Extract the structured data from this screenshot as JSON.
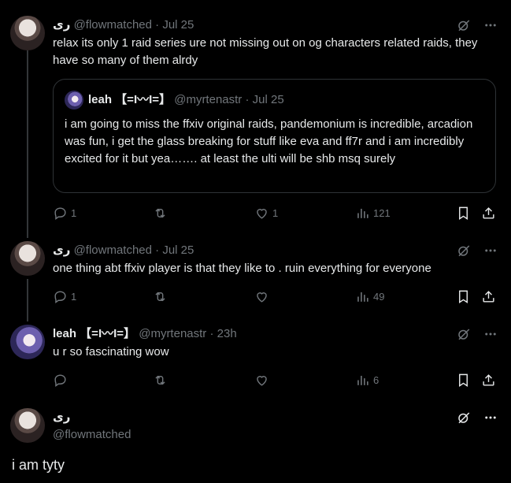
{
  "tweets": [
    {
      "name": "ری",
      "handle": "@flowmatched",
      "sep": "·",
      "time": "Jul 25",
      "text": "relax its only 1 raid series ure not missing out on og characters related raids, they have so many of them alrdy",
      "quote": {
        "name": "leah 【=Ι〰Ι=】",
        "handle": "@myrtenastr",
        "sep": "·",
        "time": "Jul 25",
        "text": "i am going to miss the ffxiv original raids, pandemonium is incredible, arcadion was fun, i get the glass breaking for stuff like eva and ff7r and i am incredibly excited for it but yea……. at least the ulti will be shb msq surely"
      },
      "replies": "1",
      "retweets": "",
      "likes": "1",
      "views": "121"
    },
    {
      "name": "ری",
      "handle": "@flowmatched",
      "sep": "·",
      "time": "Jul 25",
      "text": "one thing abt ffxiv player is that they like to . ruin everything for everyone",
      "replies": "1",
      "retweets": "",
      "likes": "",
      "views": "49"
    },
    {
      "name": "leah 【=Ι〰Ι=】",
      "handle": "@myrtenastr",
      "sep": "·",
      "time": "23h",
      "text": "u r so fascinating wow",
      "replies": "",
      "retweets": "",
      "likes": "",
      "views": "6"
    }
  ],
  "main": {
    "name": "ری",
    "handle": "@flowmatched",
    "text": "i am tyty"
  },
  "colors": {
    "bg": "#000000",
    "text": "#e7e9ea",
    "muted": "#71767b",
    "border": "#2f3336"
  }
}
